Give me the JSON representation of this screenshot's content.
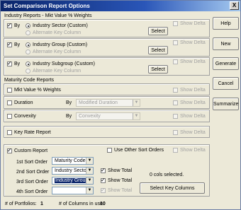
{
  "window": {
    "title": "Set Comparison Report Options",
    "close_glyph": "X"
  },
  "industry_section": {
    "title": "Industry Reports - Mkt Value % Weights",
    "rows": [
      {
        "by_label": "By",
        "by_checked": true,
        "radio1_label": "Industry Sector (Custom)",
        "radio2_label": "Alternate Key Column",
        "select_label": "Select",
        "show_delta_label": "Show Delta"
      },
      {
        "by_label": "By",
        "by_checked": true,
        "radio1_label": "Industry Group (Custom)",
        "radio2_label": "Alternate Key Column",
        "select_label": "Select",
        "show_delta_label": "Show Delta"
      },
      {
        "by_label": "By",
        "by_checked": true,
        "radio1_label": "Industry Subgroup (Custom)",
        "radio2_label": "Alternate Key Column",
        "select_label": "Select",
        "show_delta_label": "Show Delta"
      }
    ]
  },
  "maturity_section": {
    "title": "Maturity Code Reports",
    "mkt_value_label": "Mkt Value % Weights",
    "duration_label": "Duration",
    "duration_by": "By",
    "duration_value": "Modified Duration",
    "convexity_label": "Convexity",
    "convexity_by": "By",
    "convexity_value": "Convexity",
    "show_delta_label": "Show Delta"
  },
  "key_rate": {
    "label": "Key Rate Report",
    "show_delta_label": "Show Delta"
  },
  "custom_report": {
    "label": "Custom Report",
    "use_other_label": "Use Other Sort Orders",
    "show_delta_label": "Show Delta",
    "sort_orders": [
      {
        "label": "1st Sort Order",
        "value": "Maturity Code"
      },
      {
        "label": "2nd Sort Order",
        "value": "Industry Sector"
      },
      {
        "label": "3rd Sort Order",
        "value": "Industry Group"
      },
      {
        "label": "4th Sort Order",
        "value": ""
      }
    ],
    "show_total_label": "Show Total",
    "cols_selected": "0 cols selected.",
    "select_key_columns": "Select Key Columns"
  },
  "footer": {
    "portfolios_label": "# of Portfolios:",
    "portfolios_value": "1",
    "columns_label": "# of Columns in use:",
    "columns_value": "10"
  },
  "side_buttons": {
    "help": "Help",
    "new": "New",
    "generate": "Generate",
    "cancel": "Cancel",
    "summarize": "Summarize"
  }
}
